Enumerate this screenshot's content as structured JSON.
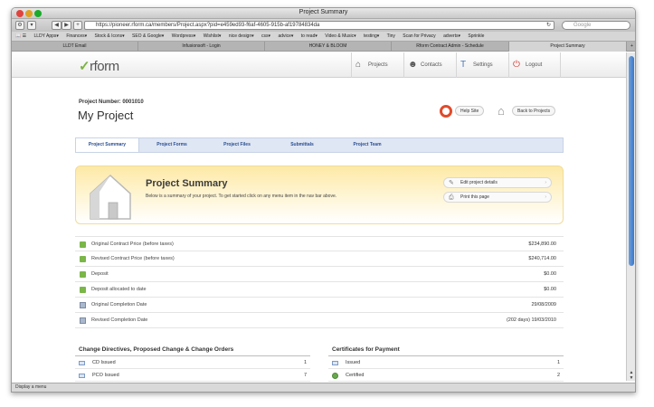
{
  "browser": {
    "window_title": "Project Summary",
    "url": "https://pioneer.rform.ca/members/Project.aspx?pid=e459ed93-f6af-4605-915b-af19784834da",
    "search_placeholder": "Google",
    "back_label": "◀",
    "forward_label": "▶",
    "add_label": "+",
    "reload_icon": "reload-icon",
    "bookmarks": [
      "LLDY Apps▾",
      "Finances▾",
      "Stock & Icons▾",
      "SEO & Google▾",
      "Wordpress▾",
      "Wishlist▾",
      "nice design▾",
      "css▾",
      "advice▾",
      "to read▾",
      "Video & Music▾",
      "testing▾",
      "Tiny",
      "Scan for Privacy",
      "adverts▾",
      "Sprinkle"
    ],
    "tabs": [
      "LLDT Email",
      "Infusionsoft - Login",
      "HONEY & BLOOM",
      "Rform Contract Admin - Schedule",
      "Project Summary"
    ],
    "active_tab": 4,
    "status": "Display a menu"
  },
  "site": {
    "logo": "rform",
    "logo_mark": "✓",
    "nav": {
      "projects": "Projects",
      "contacts": "Contacts",
      "settings": "Settings",
      "logout": "Logout"
    }
  },
  "project": {
    "number_label": "Project Number: 0001010",
    "title": "My Project",
    "help_label": "Help Site",
    "back_label": "Back to Projects"
  },
  "subnav": [
    "Project Summary",
    "Project Forms",
    "Project Files",
    "Submittals",
    "Project Team"
  ],
  "summary": {
    "title": "Project Summary",
    "description": "Below is a summary of your project. To get started click on any menu item in the nav bar above.",
    "edit_label": "Edit project details",
    "print_label": "Print this page"
  },
  "rows": [
    {
      "label": "Original Contract Price (before taxes)",
      "value": "$234,890.00",
      "icon": "money"
    },
    {
      "label": "Revised Contract Price (before taxes)",
      "value": "$240,714.00",
      "icon": "money"
    },
    {
      "label": "Deposit",
      "value": "$0.00",
      "icon": "money"
    },
    {
      "label": "Deposit allocated to date",
      "value": "$0.00",
      "icon": "money"
    },
    {
      "label": "Original Completion Date",
      "value": "29/08/2009",
      "icon": "cal"
    },
    {
      "label": "Revised Completion Date",
      "value": "(202 days) 19/03/2010",
      "icon": "cal"
    }
  ],
  "changes": {
    "heading": "Change Directives, Proposed Change & Change Orders",
    "items": [
      {
        "label": "CD Issued",
        "value": "1"
      },
      {
        "label": "PCO Issued",
        "value": "7"
      }
    ]
  },
  "certificates": {
    "heading": "Certificates for Payment",
    "items": [
      {
        "label": "Issued",
        "value": "1"
      },
      {
        "label": "Certified",
        "value": "2"
      }
    ]
  }
}
